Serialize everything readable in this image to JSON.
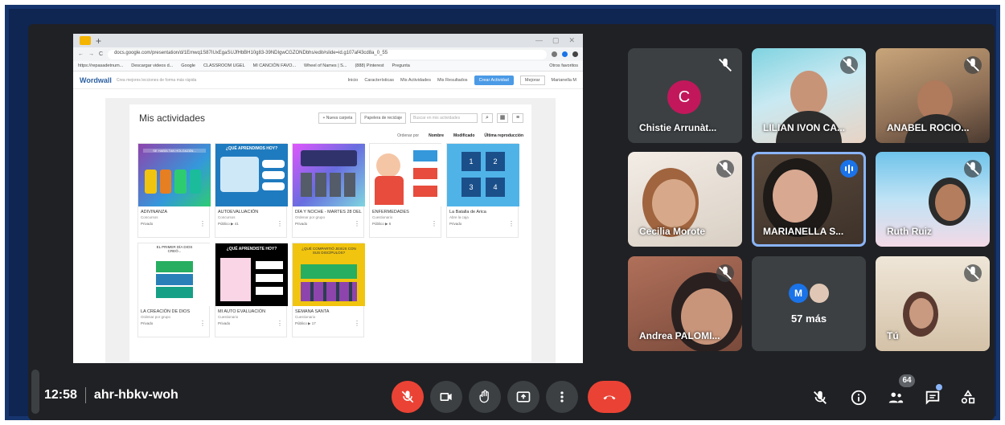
{
  "browser": {
    "url": "docs.google.com/presentation/d/1Emwq1S87IUxEgaSUJfHbBH10g83-39NDIgwCGZONDbhs/edit#slide=id.g107af43cd8a_0_55",
    "bookmarks": [
      "https://repasadetnum...",
      "Descargar videos d...",
      "Google",
      "CLASSROOM UGEL",
      "MI CANCIÓN FAVO...",
      "Wheel of Names | S...",
      "(888) Pinterest",
      "Pregunta",
      "Otros favoritos"
    ]
  },
  "wordwall": {
    "logo": "Wordwall",
    "tagline": "Crea mejores lecciones de forma más rápida",
    "nav": [
      "Inicio",
      "Características",
      "Mis Actividades",
      "Mis Resultados"
    ],
    "create_btn": "Crear Actividad",
    "upgrade_btn": "Mejorar",
    "user": "Marianella M",
    "page_title": "Mis actividades",
    "new_folder": "+ Nueva carpeta",
    "recycle": "Papelera de reciclaje",
    "search_placeholder": "Buscar en mis actividades",
    "sort_label": "Ordenar por",
    "sort_options": [
      "Nombre",
      "Modificado",
      "Última reproducción"
    ],
    "cards": [
      {
        "title": "ADIVINANZA",
        "type": "Concursos",
        "meta": "Privado"
      },
      {
        "title": "AUTOEVALUACIÓN",
        "type": "Concursos",
        "meta": "Público  ▶ 41"
      },
      {
        "title": "DÍA Y NOCHE - MARTES 28 DEL",
        "type": "Ordenar por grupo",
        "meta": "Privado"
      },
      {
        "title": "ENFERMEDADES",
        "type": "Cuestionario",
        "meta": "Público  ▶ 6"
      },
      {
        "title": "La Batalla de Arica",
        "type": "Abre la caja",
        "meta": "Privado"
      },
      {
        "title": "LA CREACIÓN DE DIOS",
        "type": "Ordenar por grupo",
        "meta": "Privado"
      },
      {
        "title": "MI AUTO EVALUACIÓN",
        "type": "Cuestionario",
        "meta": "Privado"
      },
      {
        "title": "SEMANA SANTA",
        "type": "Cuestionario",
        "meta": "Público  ▶ 17"
      }
    ],
    "thumb_texts": {
      "c0": "SE HABÍA TAN HOLGAZÁN...",
      "c1": "¿QUÉ APRENDIMOS HOY?",
      "c6": "¿QUÉ APRENDISTE HOY?",
      "c5": "EL PRIMER DÍA DIOS CREÓ...",
      "c7": "¿QUÉ COMPARTIÓ JESÚS CON SUS DISCÍPULOS?"
    }
  },
  "participants": [
    {
      "name": "Chistie Arrunàt...",
      "initial": "C"
    },
    {
      "name": "LILIAN IVON CA..."
    },
    {
      "name": "ANABEL ROCIO..."
    },
    {
      "name": "Cecilia Morote"
    },
    {
      "name": "MARIANELLA S..."
    },
    {
      "name": "Ruth Ruiz"
    },
    {
      "name": "Andrea PALOMI..."
    },
    {
      "name": "57 más",
      "initial": "M"
    },
    {
      "name": "Tú"
    }
  ],
  "meeting": {
    "time": "12:58",
    "code": "ahr-hbkv-woh",
    "participant_count": "64"
  },
  "colors": {
    "background": "#202124",
    "tile": "#3c4043",
    "red": "#ea4335",
    "accent_blue": "#8ab4f8",
    "frame": "#16356e"
  }
}
